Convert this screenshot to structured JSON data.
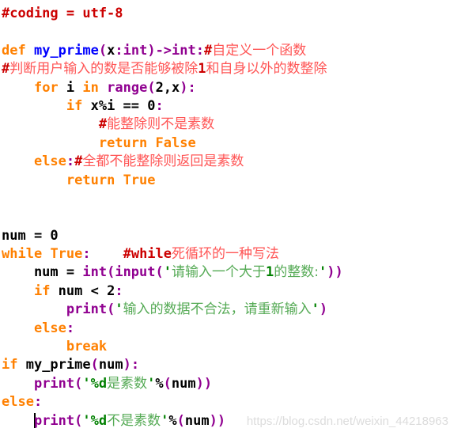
{
  "editor": {
    "language": "Python",
    "background_color": "#ffffff",
    "font_size_px": 17,
    "caret_line_index": 24,
    "palette": {
      "keyword": "#ff8000",
      "function_name": "#0000ff",
      "builtin": "#900090",
      "punctuation": "#900090",
      "plain": "#000000",
      "string_cjk": "#55aa55",
      "string_ascii": "#008000",
      "comment_cjk": "#ff5555",
      "comment_ascii": "#cc0000"
    },
    "lines": [
      {
        "id": "line-1",
        "text": "#coding = utf-8"
      },
      {
        "id": "line-2",
        "text": ""
      },
      {
        "id": "line-3",
        "text": "def my_prime(x:int)->int:#自定义一个函数"
      },
      {
        "id": "line-4",
        "text": "#判断用户输入的数是否能够被除1和自身以外的数整除"
      },
      {
        "id": "line-5",
        "text": "    for i in range(2,x):"
      },
      {
        "id": "line-6",
        "text": "        if x%i == 0:"
      },
      {
        "id": "line-7",
        "text": "            #能整除则不是素数"
      },
      {
        "id": "line-8",
        "text": "            return False"
      },
      {
        "id": "line-9",
        "text": "    else:#全都不能整除则返回是素数"
      },
      {
        "id": "line-10",
        "text": "        return True"
      },
      {
        "id": "line-11",
        "text": ""
      },
      {
        "id": "line-12",
        "text": ""
      },
      {
        "id": "line-13",
        "text": "num = 0"
      },
      {
        "id": "line-14",
        "text": "while True:    #while死循环的一种写法"
      },
      {
        "id": "line-15",
        "text": "    num = int(input('请输入一个大于1的整数:'))"
      },
      {
        "id": "line-16",
        "text": "    if num < 2:"
      },
      {
        "id": "line-17",
        "text": "        print('输入的数据不合法，请重新输入')"
      },
      {
        "id": "line-18",
        "text": "    else:"
      },
      {
        "id": "line-19",
        "text": "        break"
      },
      {
        "id": "line-20",
        "text": "if my_prime(num):"
      },
      {
        "id": "line-21",
        "text": "    print('%d是素数'%(num))"
      },
      {
        "id": "line-22",
        "text": "else:"
      },
      {
        "id": "line-23",
        "text": "    print('%d不是素数'%(num))"
      }
    ],
    "tokens": {
      "l1": {
        "c1": "#coding = utf-8"
      },
      "l3": {
        "t1": "def",
        "t2": " ",
        "t3": "my_prime",
        "t4": "(",
        "t5": "x",
        "t6": ":",
        "t7": "int",
        "t8": ")->",
        "t9": "int",
        "t10": ":",
        "t11": "#",
        "t12": "自定义一个函数"
      },
      "l4": {
        "t1": "#",
        "t2": "判断用户输入的数是否能够被除",
        "t3": "1",
        "t4": "和自身以外的数整除"
      },
      "l5": {
        "t1": "    ",
        "t2": "for",
        "t3": " i ",
        "t4": "in",
        "t5": " ",
        "t6": "range",
        "t7": "(",
        "t8": "2,x",
        "t9": "):"
      },
      "l6": {
        "t1": "        ",
        "t2": "if",
        "t3": " x%i == 0",
        "t4": ":"
      },
      "l7": {
        "t1": "            ",
        "t2": "#",
        "t3": "能整除则不是素数"
      },
      "l8": {
        "t1": "            ",
        "t2": "return",
        "t3": " ",
        "t4": "False"
      },
      "l9": {
        "t1": "    ",
        "t2": "else",
        "t3": ":",
        "t4": "#",
        "t5": "全都不能整除则返回是素数"
      },
      "l10": {
        "t1": "        ",
        "t2": "return",
        "t3": " ",
        "t4": "True"
      },
      "l13": {
        "t1": "num = 0"
      },
      "l14": {
        "t1": "while",
        "t2": " ",
        "t3": "True",
        "t4": ":",
        "t5": "    ",
        "t6": "#while",
        "t7": "死循环的一种写法"
      },
      "l15": {
        "t1": "    num = ",
        "t2": "int",
        "t3": "(",
        "t4": "input",
        "t5": "(",
        "t6": "'",
        "t7": "请输入一个大于",
        "t8": "1",
        "t9": "的整数:",
        "t10": "'",
        "t11": "))"
      },
      "l16": {
        "t1": "    ",
        "t2": "if",
        "t3": " num < 2",
        "t4": ":"
      },
      "l17": {
        "t1": "        ",
        "t2": "print",
        "t3": "(",
        "t4": "'",
        "t5": "输入的数据不合法，请重新输入",
        "t6": "'",
        "t7": ")"
      },
      "l18": {
        "t1": "    ",
        "t2": "else",
        "t3": ":"
      },
      "l19": {
        "t1": "        ",
        "t2": "break"
      },
      "l20": {
        "t1": "if",
        "t2": " my_prime",
        "t3": "(",
        "t4": "num",
        "t5": "):"
      },
      "l21": {
        "t1": "    ",
        "t2": "print",
        "t3": "(",
        "t4": "'%d",
        "t5": "是素数",
        "t6": "'",
        "t7": "%",
        "t8": "(",
        "t9": "num",
        "t10": "))"
      },
      "l22": {
        "t1": "else",
        "t2": ":"
      },
      "l23": {
        "t1": "    ",
        "t2": "print",
        "t3": "(",
        "t4": "'%d",
        "t5": "不是素数",
        "t6": "'",
        "t7": "%",
        "t8": "(",
        "t9": "num",
        "t10": "))"
      }
    }
  },
  "watermark": {
    "text": "https://blog.csdn.net/weixin_44218963"
  }
}
